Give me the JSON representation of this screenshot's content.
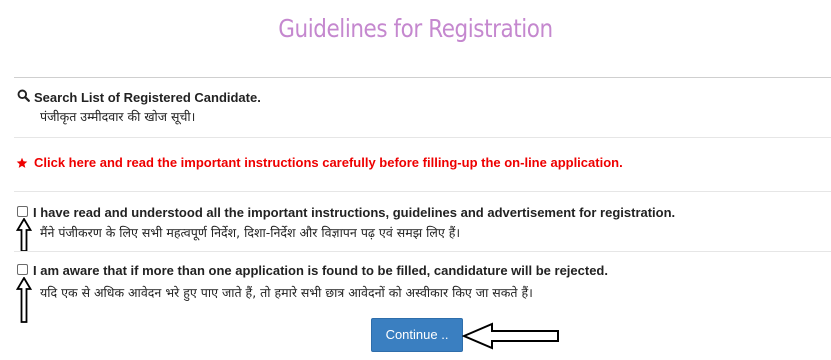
{
  "page": {
    "title": "Guidelines for Registration"
  },
  "search": {
    "label": "Search List of Registered Candidate.",
    "label_hindi": "पंजीकृत उम्मीदवार की खोज सूची।",
    "icon": "search-icon"
  },
  "instructions": {
    "label": "Click here and read the important instructions carefully before filling-up the on-line application.",
    "icon": "star-icon",
    "color": "#ee0000"
  },
  "declarations": [
    {
      "text": "I have read and understood all the important instructions, guidelines and advertisement for registration.",
      "text_hindi": "मैंने पंजीकरण के लिए सभी महत्वपूर्ण निर्देश, दिशा-निर्देश और विज्ञापन पढ़ एवं समझ लिए हैं।",
      "checked": false
    },
    {
      "text": "I am aware that if more than one application is found to be filled, candidature will be rejected.",
      "text_hindi": "यदि एक से अधिक आवेदन भरे हुए पाए जाते हैं, तो हमारे सभी छात्र आवेदनों को अस्वीकार किए जा सकते हैं।",
      "checked": false
    }
  ],
  "continue_button": {
    "label": "Continue ..",
    "color": "#3a7fc1"
  },
  "colors": {
    "title": "#c588cf",
    "divider": "#dddddd"
  }
}
